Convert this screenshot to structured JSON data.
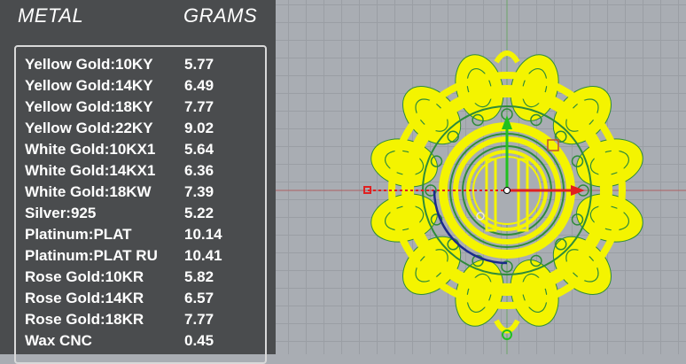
{
  "panel": {
    "header_metal": "METAL",
    "header_grams": "GRAMS",
    "rows": [
      {
        "metal": "Yellow Gold:10KY",
        "grams": "5.77"
      },
      {
        "metal": "Yellow Gold:14KY",
        "grams": "6.49"
      },
      {
        "metal": "Yellow Gold:18KY",
        "grams": "7.77"
      },
      {
        "metal": "Yellow Gold:22KY",
        "grams": "9.02"
      },
      {
        "metal": "White Gold:10KX1",
        "grams": "5.64"
      },
      {
        "metal": "White Gold:14KX1",
        "grams": "6.36"
      },
      {
        "metal": "White Gold:18KW",
        "grams": "7.39"
      },
      {
        "metal": "Silver:925",
        "grams": "5.22"
      },
      {
        "metal": "Platinum:PLAT",
        "grams": "10.14"
      },
      {
        "metal": "Platinum:PLAT RU",
        "grams": "10.41"
      },
      {
        "metal": "Rose Gold:10KR",
        "grams": "5.82"
      },
      {
        "metal": "Rose Gold:14KR",
        "grams": "6.57"
      },
      {
        "metal": "Rose Gold:18KR",
        "grams": "7.77"
      },
      {
        "metal": "Wax  CNC",
        "grams": "0.45"
      }
    ]
  },
  "viewport": {
    "background_color": "#a9adb3",
    "grid_color": "#9a9ea4",
    "wireframe_color": "#f4f400",
    "wireframe_detail_color": "#2e8b3a",
    "axis_x_color": "#e02020",
    "axis_y_color": "#20c020",
    "gumball_arc_color": "#1a2a8a"
  }
}
